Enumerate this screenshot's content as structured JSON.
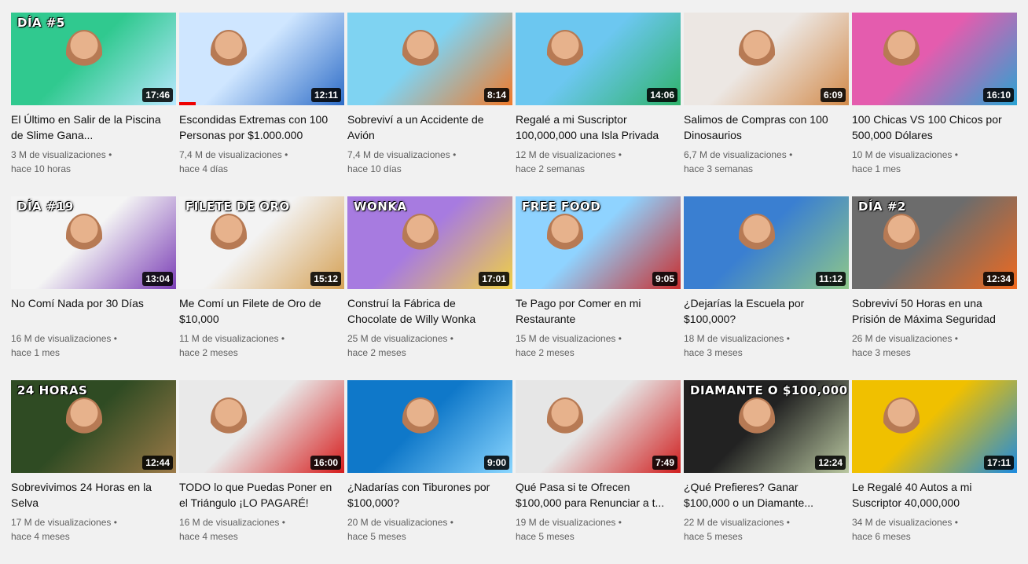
{
  "videos": [
    {
      "title": "El Último en Salir de la Piscina de Slime Gana...",
      "views": "3 M de visualizaciones",
      "age": "hace 10 horas",
      "duration": "17:46",
      "overlay": "DÍA #5",
      "progress": 0,
      "colors": [
        "#30c98f",
        "#b7e8ff"
      ]
    },
    {
      "title": "Escondidas Extremas con 100 Personas por $1.000.000",
      "views": "7,4 M de visualizaciones",
      "age": "hace 4 días",
      "duration": "12:11",
      "overlay": "",
      "progress": 0.1,
      "colors": [
        "#cfe6ff",
        "#2d6cc7"
      ]
    },
    {
      "title": "Sobreviví a un Accidente de Avión",
      "views": "7,4 M de visualizaciones",
      "age": "hace 10 días",
      "duration": "8:14",
      "overlay": "",
      "progress": 0,
      "colors": [
        "#7fd3f2",
        "#f07a2a"
      ]
    },
    {
      "title": "Regalé a mi Suscriptor 100,000,000 una Isla Privada",
      "views": "12 M de visualizaciones",
      "age": "hace 2 semanas",
      "duration": "14:06",
      "overlay": "",
      "progress": 0,
      "colors": [
        "#6cc7f0",
        "#2fb36b"
      ]
    },
    {
      "title": "Salimos de Compras con 100 Dinosaurios",
      "views": "6,7 M de visualizaciones",
      "age": "hace 3 semanas",
      "duration": "6:09",
      "overlay": "",
      "progress": 0,
      "colors": [
        "#ece7e3",
        "#d28a4a"
      ]
    },
    {
      "title": "100 Chicas VS 100 Chicos por 500,000 Dólares",
      "views": "10 M de visualizaciones",
      "age": "hace 1 mes",
      "duration": "16:10",
      "overlay": "",
      "progress": 0,
      "colors": [
        "#e45cae",
        "#2aa3d3"
      ]
    },
    {
      "title": "No Comí Nada por 30 Días",
      "views": "16 M de visualizaciones",
      "age": "hace 1 mes",
      "duration": "13:04",
      "overlay": "DÍA #19",
      "progress": 0,
      "colors": [
        "#f4f4f4",
        "#7b3fb6"
      ]
    },
    {
      "title": "Me Comí un Filete de Oro de $10,000",
      "views": "11 M de visualizaciones",
      "age": "hace 2 meses",
      "duration": "15:12",
      "overlay": "FILETE DE ORO",
      "progress": 0,
      "colors": [
        "#f3f3f3",
        "#d5a155"
      ]
    },
    {
      "title": "Construí la Fábrica de Chocolate de Willy Wonka",
      "views": "25 M de visualizaciones",
      "age": "hace 2 meses",
      "duration": "17:01",
      "overlay": "WONKA",
      "progress": 0,
      "colors": [
        "#a77be0",
        "#f0d045"
      ]
    },
    {
      "title": "Te Pago por Comer en mi Restaurante",
      "views": "15 M de visualizaciones",
      "age": "hace 2 meses",
      "duration": "9:05",
      "overlay": "FREE FOOD",
      "progress": 0,
      "colors": [
        "#8fd3ff",
        "#c92e2e"
      ]
    },
    {
      "title": "¿Dejarías la Escuela por $100,000?",
      "views": "18 M de visualizaciones",
      "age": "hace 3 meses",
      "duration": "11:12",
      "overlay": "",
      "progress": 0,
      "colors": [
        "#3a7fd1",
        "#8ec78a"
      ]
    },
    {
      "title": "Sobreviví 50 Horas en una Prisión de Máxima Seguridad",
      "views": "26 M de visualizaciones",
      "age": "hace 3 meses",
      "duration": "12:34",
      "overlay": "DÍA #2",
      "progress": 0,
      "colors": [
        "#6c6c6c",
        "#ef6a1f"
      ]
    },
    {
      "title": "Sobrevivimos 24 Horas en la Selva",
      "views": "17 M de visualizaciones",
      "age": "hace 4 meses",
      "duration": "12:44",
      "overlay": "24 HORAS",
      "progress": 0,
      "colors": [
        "#2f4b23",
        "#9c7a48"
      ]
    },
    {
      "title": "TODO lo que Puedas Poner en el Triángulo ¡LO PAGARÉ!",
      "views": "16 M de visualizaciones",
      "age": "hace 4 meses",
      "duration": "16:00",
      "overlay": "",
      "progress": 0,
      "colors": [
        "#e9e9e9",
        "#d61c1c"
      ]
    },
    {
      "title": "¿Nadarías con Tiburones por $100,000?",
      "views": "20 M de visualizaciones",
      "age": "hace 5 meses",
      "duration": "9:00",
      "overlay": "",
      "progress": 0,
      "colors": [
        "#0f78c9",
        "#8ad6ff"
      ]
    },
    {
      "title": "Qué Pasa si te Ofrecen $100,000 para Renunciar a t...",
      "views": "19 M de visualizaciones",
      "age": "hace 5 meses",
      "duration": "7:49",
      "overlay": "",
      "progress": 0,
      "colors": [
        "#e6e6e6",
        "#d01f1f"
      ]
    },
    {
      "title": "¿Qué Prefieres? Ganar $100,000 o un Diamante...",
      "views": "22 M de visualizaciones",
      "age": "hace 5 meses",
      "duration": "12:24",
      "overlay": "DIAMANTE O $100,000",
      "progress": 0,
      "colors": [
        "#222",
        "#b9c7a0"
      ]
    },
    {
      "title": "Le Regalé 40 Autos a mi Suscriptor 40,000,000",
      "views": "34 M de visualizaciones",
      "age": "hace 6 meses",
      "duration": "17:11",
      "overlay": "",
      "progress": 0,
      "colors": [
        "#f0c000",
        "#1c8be0"
      ]
    }
  ]
}
